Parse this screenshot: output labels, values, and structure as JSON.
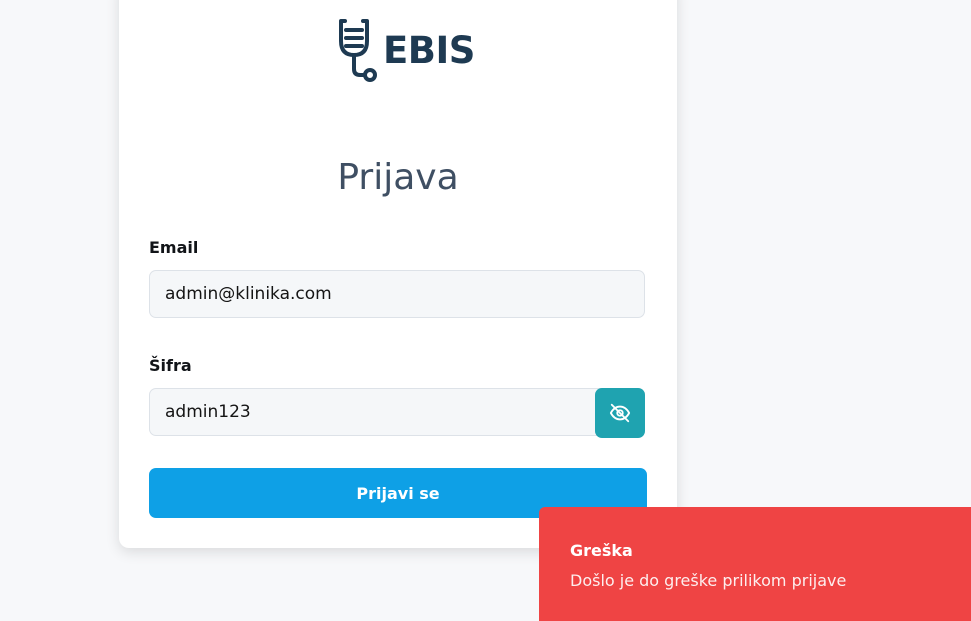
{
  "brand": {
    "name": "EBIS",
    "color": "#1e3a52"
  },
  "login": {
    "title": "Prijava",
    "email_label": "Email",
    "email_value": "admin@klinika.com",
    "password_label": "Šifra",
    "password_value": "admin123",
    "toggle_icon": "eye-off-icon",
    "submit_label": "Prijavi se"
  },
  "toast": {
    "title": "Greška",
    "message": "Došlo je do greške prilikom prijave",
    "color": "#ef4444"
  },
  "colors": {
    "primary_button": "#0ea0e6",
    "toggle_button": "#1fa3b0",
    "background": "#f7f8fa"
  }
}
